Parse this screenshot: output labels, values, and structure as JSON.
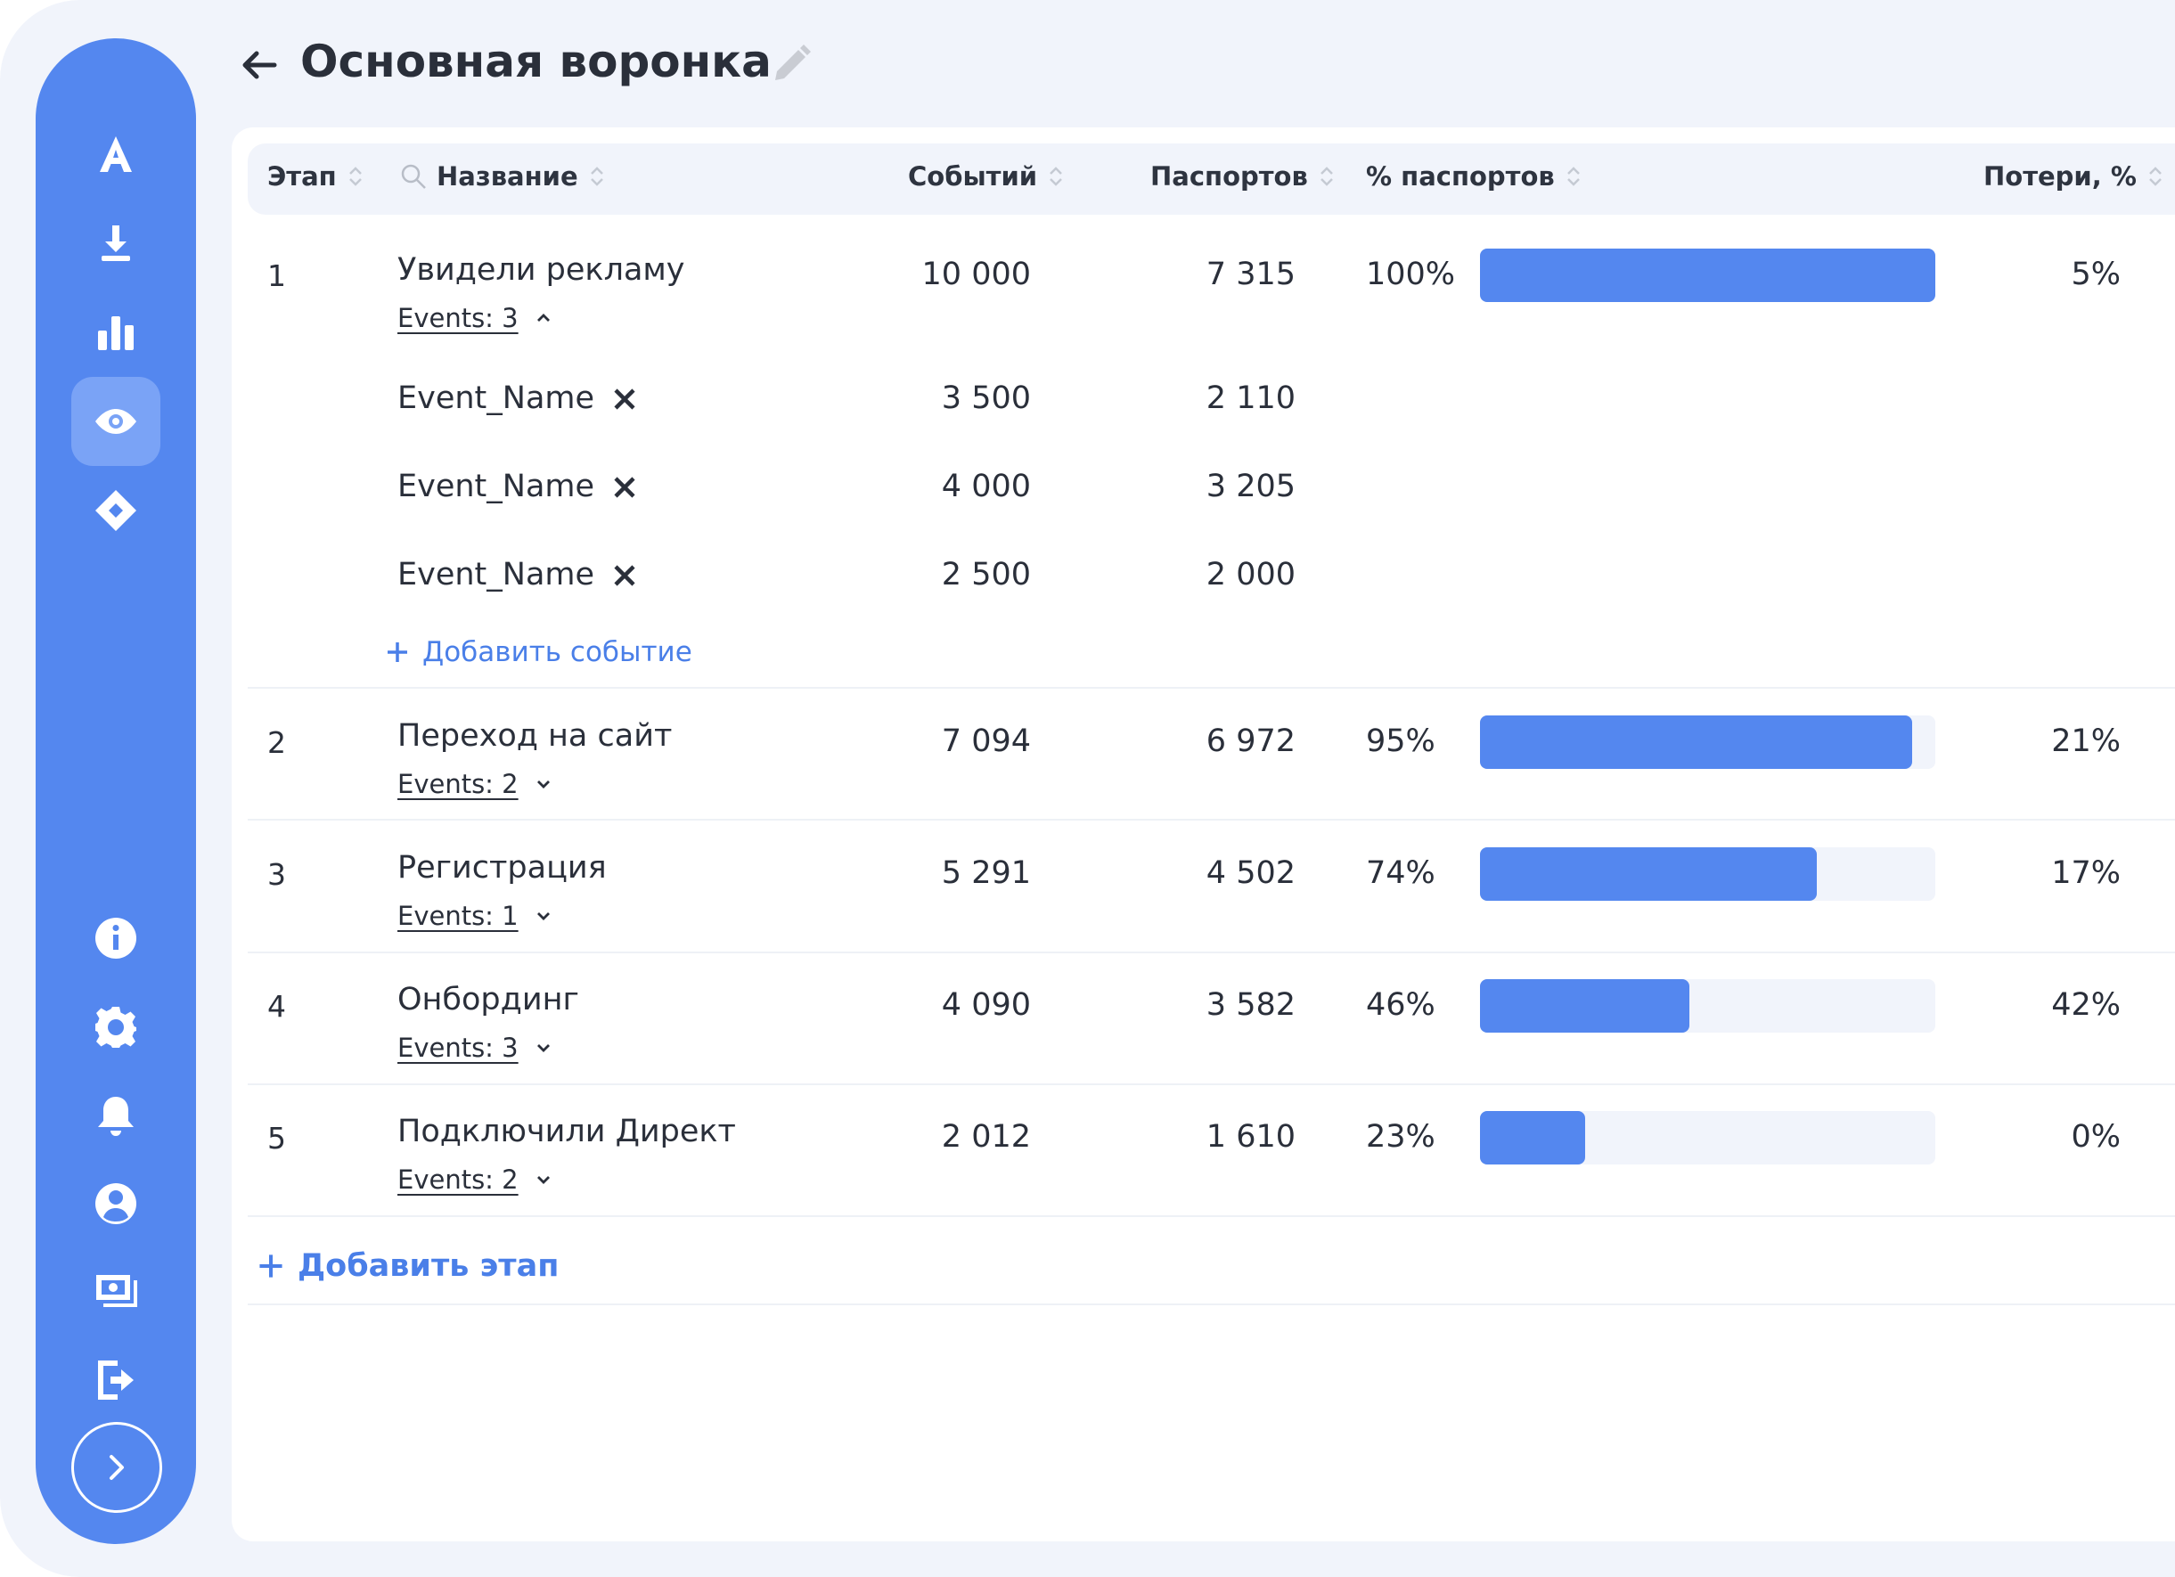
{
  "header": {
    "title": "Основная воронка"
  },
  "table": {
    "columns": {
      "stage": "Этап",
      "name": "Название",
      "events": "Событий",
      "passports": "Паспортов",
      "passports_pct": "% паспортов",
      "loss": "Потери, %"
    },
    "rows": [
      {
        "stage": "1",
        "name": "Увидели рекламу",
        "events_label": "Events: 3",
        "events": "10 000",
        "passports": "7 315",
        "pct": "100%",
        "bar_fraction": 1.0,
        "loss": "5%",
        "expanded": true
      },
      {
        "stage": "2",
        "name": "Переход на сайт",
        "events_label": "Events: 2",
        "events": "7 094",
        "passports": "6 972",
        "pct": "95%",
        "bar_fraction": 0.95,
        "loss": "21%",
        "expanded": false
      },
      {
        "stage": "3",
        "name": "Регистрация",
        "events_label": "Events: 1",
        "events": "5 291",
        "passports": "4 502",
        "pct": "74%",
        "bar_fraction": 0.74,
        "loss": "17%",
        "expanded": false
      },
      {
        "stage": "4",
        "name": "Онбординг",
        "events_label": "Events: 3",
        "events": "4 090",
        "passports": "3 582",
        "pct": "46%",
        "bar_fraction": 0.46,
        "loss": "42%",
        "expanded": false
      },
      {
        "stage": "5",
        "name": "Подключили Директ",
        "events_label": "Events: 2",
        "events": "2 012",
        "passports": "1 610",
        "pct": "23%",
        "bar_fraction": 0.23,
        "loss": "0%",
        "expanded": false
      }
    ],
    "sub_events": [
      {
        "name": "Event_Name",
        "events": "3 500",
        "passports": "2 110"
      },
      {
        "name": "Event_Name",
        "events": "4 000",
        "passports": "3 205"
      },
      {
        "name": "Event_Name",
        "events": "2 500",
        "passports": "2 000"
      }
    ],
    "add_event_label": "Добавить событие",
    "add_stage_label": "Добавить этап"
  },
  "sidebar": {
    "logo": "A",
    "top_icons": [
      "download-icon",
      "bar-chart-icon",
      "eye-icon",
      "diamond-icon"
    ],
    "active_icon": "eye-icon",
    "bottom_icons": [
      "info-icon",
      "gear-icon",
      "bell-icon",
      "user-icon",
      "money-icon",
      "logout-icon"
    ]
  },
  "colors": {
    "accent": "#5487ef",
    "bar_track": "#f1f4fb",
    "link": "#4a7fe8"
  }
}
